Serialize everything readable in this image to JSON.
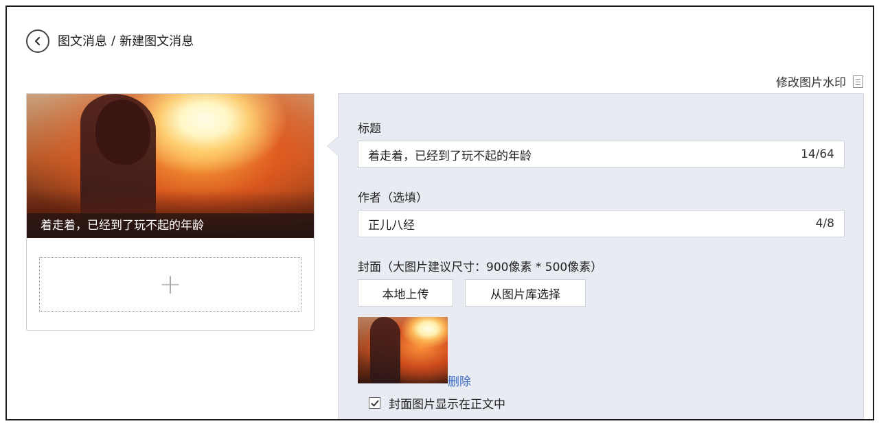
{
  "header": {
    "breadcrumb_parent": "图文消息",
    "breadcrumb_separator": "/",
    "breadcrumb_current": "新建图文消息",
    "watermark_link": "修改图片水印"
  },
  "preview": {
    "caption": "着走着，已经到了玩不起的年龄",
    "add_icon": "plus-icon"
  },
  "form": {
    "title_label": "标题",
    "title_value": "着走着，已经到了玩不起的年龄",
    "title_counter": "14/64",
    "author_label": "作者（选填）",
    "author_value": "正儿八经",
    "author_counter": "4/8",
    "cover_label": "封面（大图片建议尺寸：900像素 * 500像素）",
    "upload_local_label": "本地上传",
    "choose_library_label": "从图片库选择",
    "delete_label": "删除",
    "show_cover_label": "封面图片显示在正文中",
    "show_cover_checked": true
  },
  "colors": {
    "panel_bg": "#e8ebf1",
    "link_blue": "#3a6bc4"
  }
}
